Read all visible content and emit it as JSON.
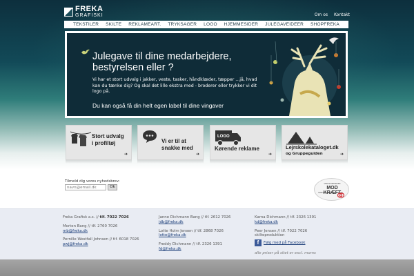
{
  "brand": {
    "logo_main": "FREKA",
    "logo_sub": "GRAFISKI"
  },
  "top_links": [
    "Om os",
    "Kontakt"
  ],
  "nav": [
    "TEKSTILER",
    "SKILTE",
    "REKLAMEART.",
    "TRYKSAGER",
    "LOGO",
    "HJEMMESIDER",
    "JULEGAVEIDEER",
    "SHOPFREKA"
  ],
  "banner": {
    "title_line1": "Julegave til dine medarbejdere,",
    "title_line2": "bestyrelsen eller ?",
    "text": "Vi har et stort udvalg i jakker, veste, tasker, håndklæder, tæpper ...jå, hvad kan du tænke dig? Og skal det lille ekstra med - broderer eller trykker vi dit logo på.",
    "label": "Du kan også få din helt egen label til dine vingaver"
  },
  "tiles": [
    {
      "line1": "Stort udvalg",
      "line2": "i profiltøj",
      "sub": ""
    },
    {
      "line1": "Vi er til at",
      "line2": "snakke med",
      "sub": ""
    },
    {
      "line1": "Kørende reklame",
      "line2": "",
      "sub": "",
      "icon_text": "LOGO"
    },
    {
      "line1": "Lejrskolekataloget.dk",
      "line2": "",
      "sub": "og Gruppeguiden"
    }
  ],
  "newsletter": {
    "label": "Tilmeld dig vores nyhedsbrev:",
    "placeholder": "navn@email.dk",
    "button": "Ok"
  },
  "badge": {
    "top": "VIRKSOMHEDER",
    "main": "MOD KRÆFT",
    "bottom": "KRÆFTENS BEKÆMPELSE"
  },
  "footer": {
    "col1": [
      {
        "text": "Freka Grafisk a.s.",
        "bold": "tlf. 7022 7026"
      },
      {
        "text": "Morten Bang // tlf. 2760 7026",
        "email": "mb@freka.dk"
      },
      {
        "text": "Pernille Westfall Johnsen // tlf. 6018 7026",
        "email": "pwj@freka.dk"
      }
    ],
    "col2": [
      {
        "text": "Janne Dichmann Bang // tlf. 2612 7026",
        "email": "jdb@freka.dk"
      },
      {
        "text": "Lotte Holm Jensen // tlf. 2868 7026",
        "email": "lotte@freka.dk"
      },
      {
        "text": "Freddy Dichmann // tlf. 2326 1391",
        "email": "fd@freka.dk"
      }
    ],
    "col3": [
      {
        "text": "Karna Dichmann // tlf. 2326 1391",
        "email": "kd@freka.dk"
      },
      {
        "text": "Peer Jensen // tlf. 7022 7026",
        "sub": "skilteproduktion"
      }
    ],
    "facebook": "Følg med på Facebook",
    "note": "alle priser på sitet er excl. moms"
  },
  "colors": {
    "accent": "#1d3f7a",
    "banner_bg": "#0f2c38",
    "header_top": "#0d2f3d",
    "footer_bg": "#e9ecf3",
    "facebook": "#3b5998"
  }
}
